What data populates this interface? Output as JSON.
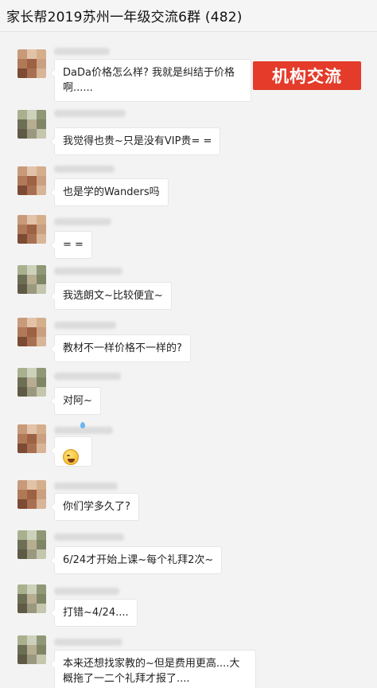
{
  "header": {
    "title": "家长帮2019苏州一年级交流6群 (482)"
  },
  "overlay_tag": {
    "label": "机构交流",
    "color": "#e43b2a"
  },
  "messages": [
    {
      "text": "DaDa价格怎么样? 我就是纠结于价格\n啊......"
    },
    {
      "text": "我觉得也贵~只是没有VIP贵= ="
    },
    {
      "text": "也是学的Wanders吗"
    },
    {
      "text": "= ="
    },
    {
      "text": "我选朗文~比较便宜~"
    },
    {
      "text": "教材不一样价格不一样的?"
    },
    {
      "text": "对阿~"
    },
    {
      "text": "",
      "icon": "crying-laughing-emoji-icon"
    },
    {
      "text": "你们学多久了?"
    },
    {
      "text": "6/24才开始上课~每个礼拜2次~"
    },
    {
      "text": "打错~4/24...."
    },
    {
      "text": "本来还想找家教的~但是费用更高....大\n概拖了一二个礼拜才报了...."
    }
  ]
}
